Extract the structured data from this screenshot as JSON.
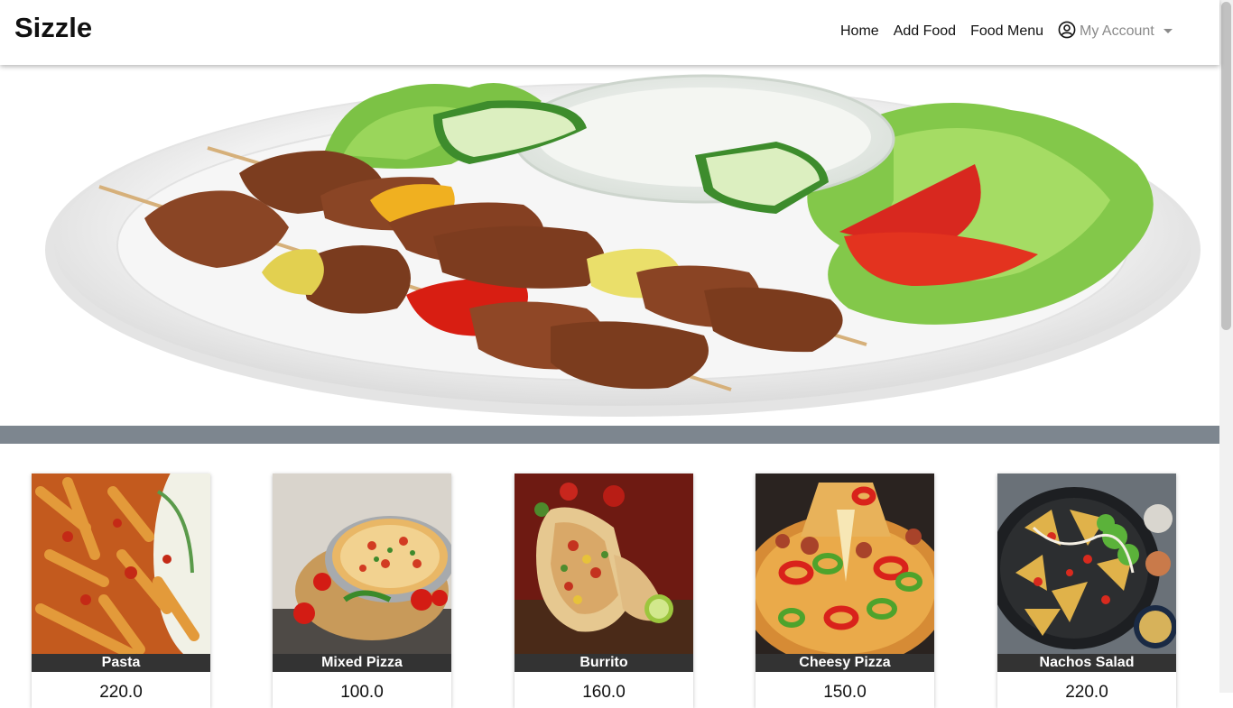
{
  "navbar": {
    "brand": "Sizzle",
    "links": [
      "Home",
      "Add Food",
      "Food Menu"
    ],
    "account_label": "My Account"
  },
  "foods": [
    {
      "name": "Pasta",
      "price": "220.0"
    },
    {
      "name": "Mixed Pizza",
      "price": "100.0"
    },
    {
      "name": "Burrito",
      "price": "160.0"
    },
    {
      "name": "Cheesy Pizza",
      "price": "150.0"
    },
    {
      "name": "Nachos Salad",
      "price": "220.0"
    }
  ]
}
